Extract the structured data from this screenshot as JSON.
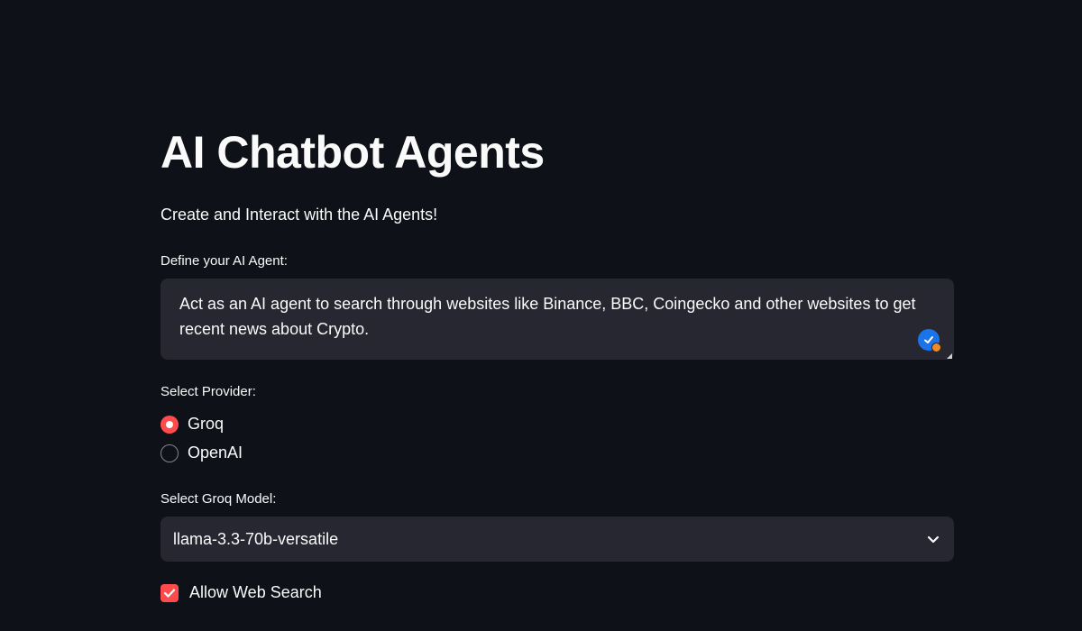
{
  "page": {
    "title": "AI Chatbot Agents",
    "subtitle": "Create and Interact with the AI Agents!"
  },
  "agent_definition": {
    "label": "Define your AI Agent:",
    "value": "Act as an AI agent to search through websites like Binance, BBC, Coingecko and other websites to get recent news about Crypto."
  },
  "provider": {
    "label": "Select Provider:",
    "options": [
      {
        "label": "Groq",
        "selected": true
      },
      {
        "label": "OpenAI",
        "selected": false
      }
    ]
  },
  "model": {
    "label": "Select Groq Model:",
    "selected_value": "llama-3.3-70b-versatile"
  },
  "web_search": {
    "label": "Allow Web Search",
    "checked": true
  },
  "colors": {
    "background": "#0e1117",
    "input_background": "#262730",
    "accent": "#ff4b4b",
    "text": "#fafafa"
  },
  "icons": {
    "grammar_badge": "grammar-check-icon",
    "select_chevron": "chevron-down-icon",
    "checkbox_check": "checkmark-icon"
  }
}
